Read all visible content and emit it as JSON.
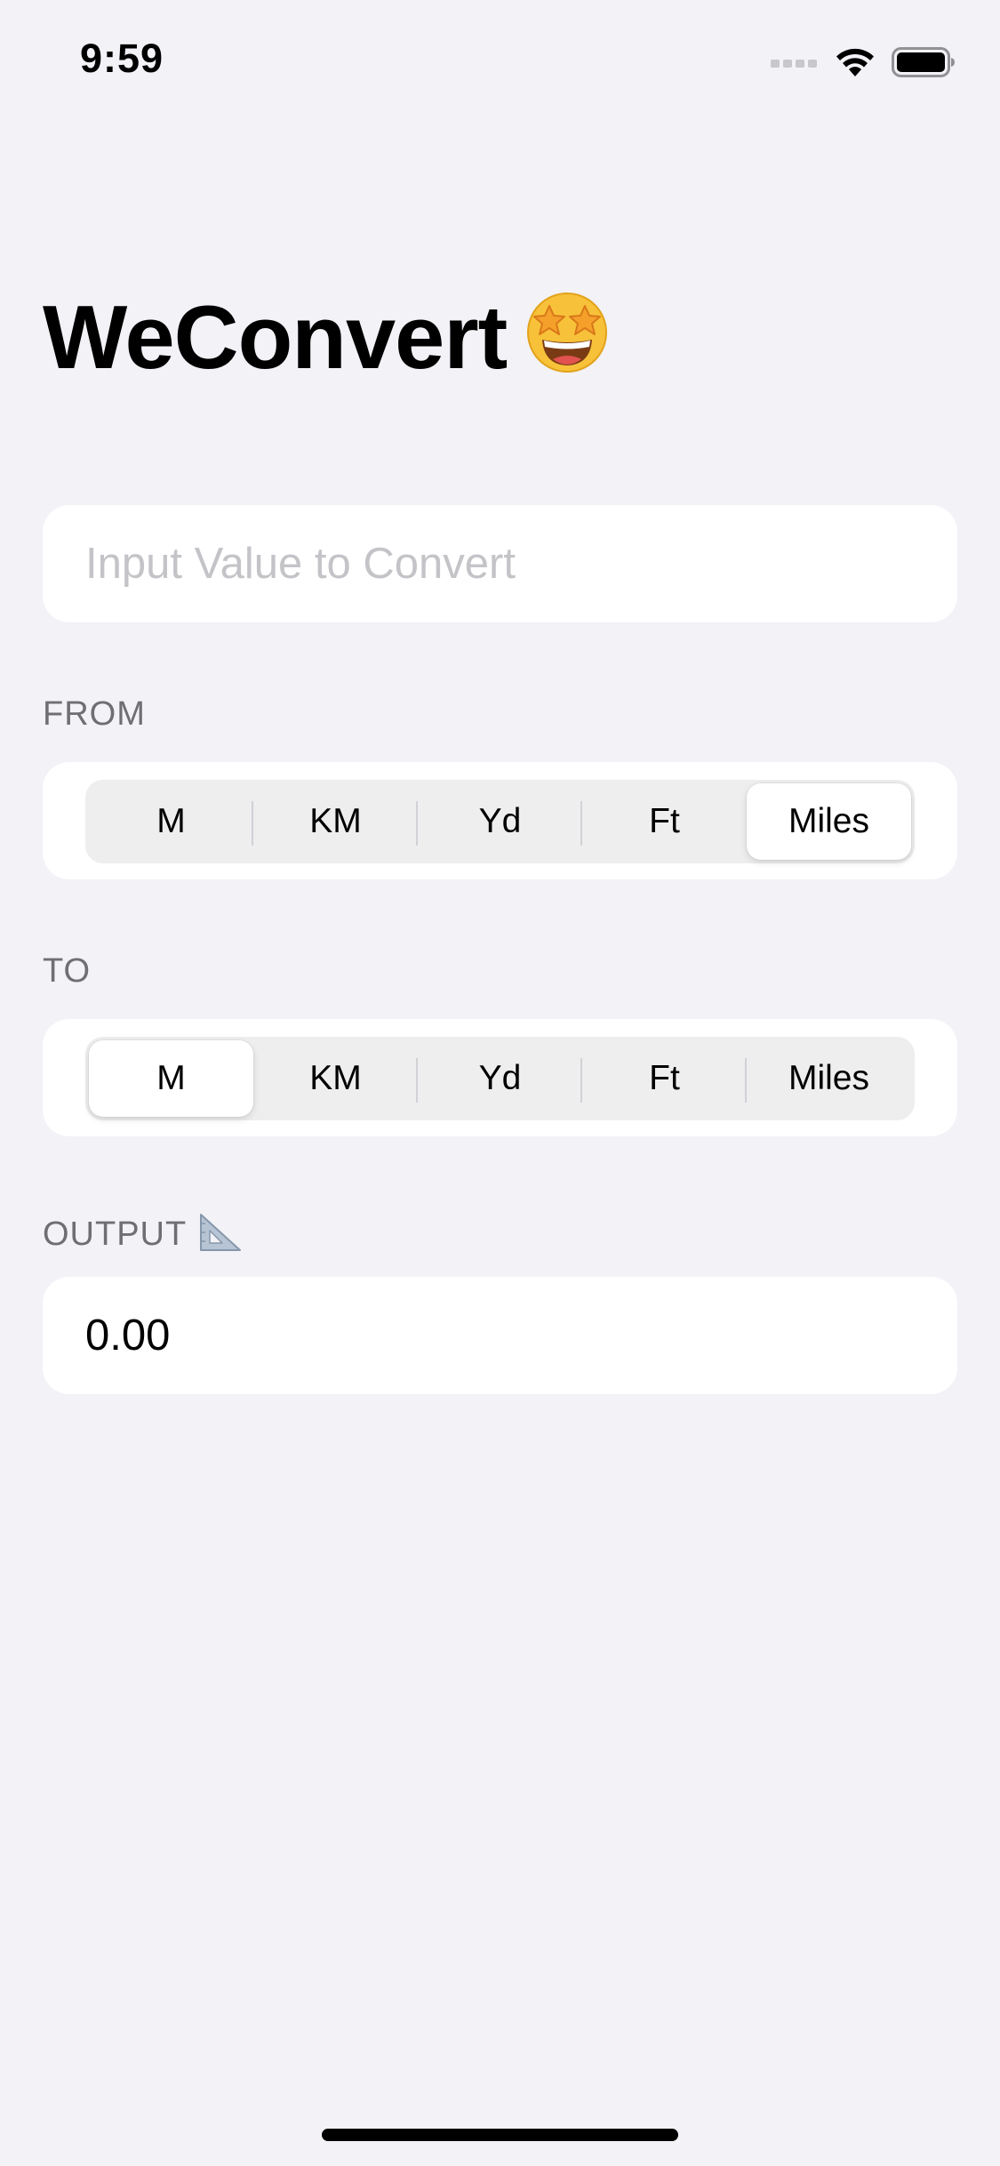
{
  "status_bar": {
    "time": "9:59",
    "icons": [
      "cellular-signal-icon",
      "wifi-icon",
      "battery-icon"
    ]
  },
  "header": {
    "title": "WeConvert",
    "title_emoji": "star-struck-emoji"
  },
  "input": {
    "placeholder": "Input Value to Convert",
    "value": ""
  },
  "from": {
    "label": "FROM",
    "options": [
      "M",
      "KM",
      "Yd",
      "Ft",
      "Miles"
    ],
    "selected": "Miles"
  },
  "to": {
    "label": "TO",
    "options": [
      "M",
      "KM",
      "Yd",
      "Ft",
      "Miles"
    ],
    "selected": "M"
  },
  "output": {
    "label": "OUTPUT",
    "label_emoji": "triangular-ruler-emoji",
    "value": "0.00"
  },
  "colors": {
    "background": "#f2f2f7",
    "card": "#ffffff",
    "segment_track": "#eeeeef",
    "label_gray": "#6e6e73",
    "placeholder_gray": "#c4c4c8"
  }
}
